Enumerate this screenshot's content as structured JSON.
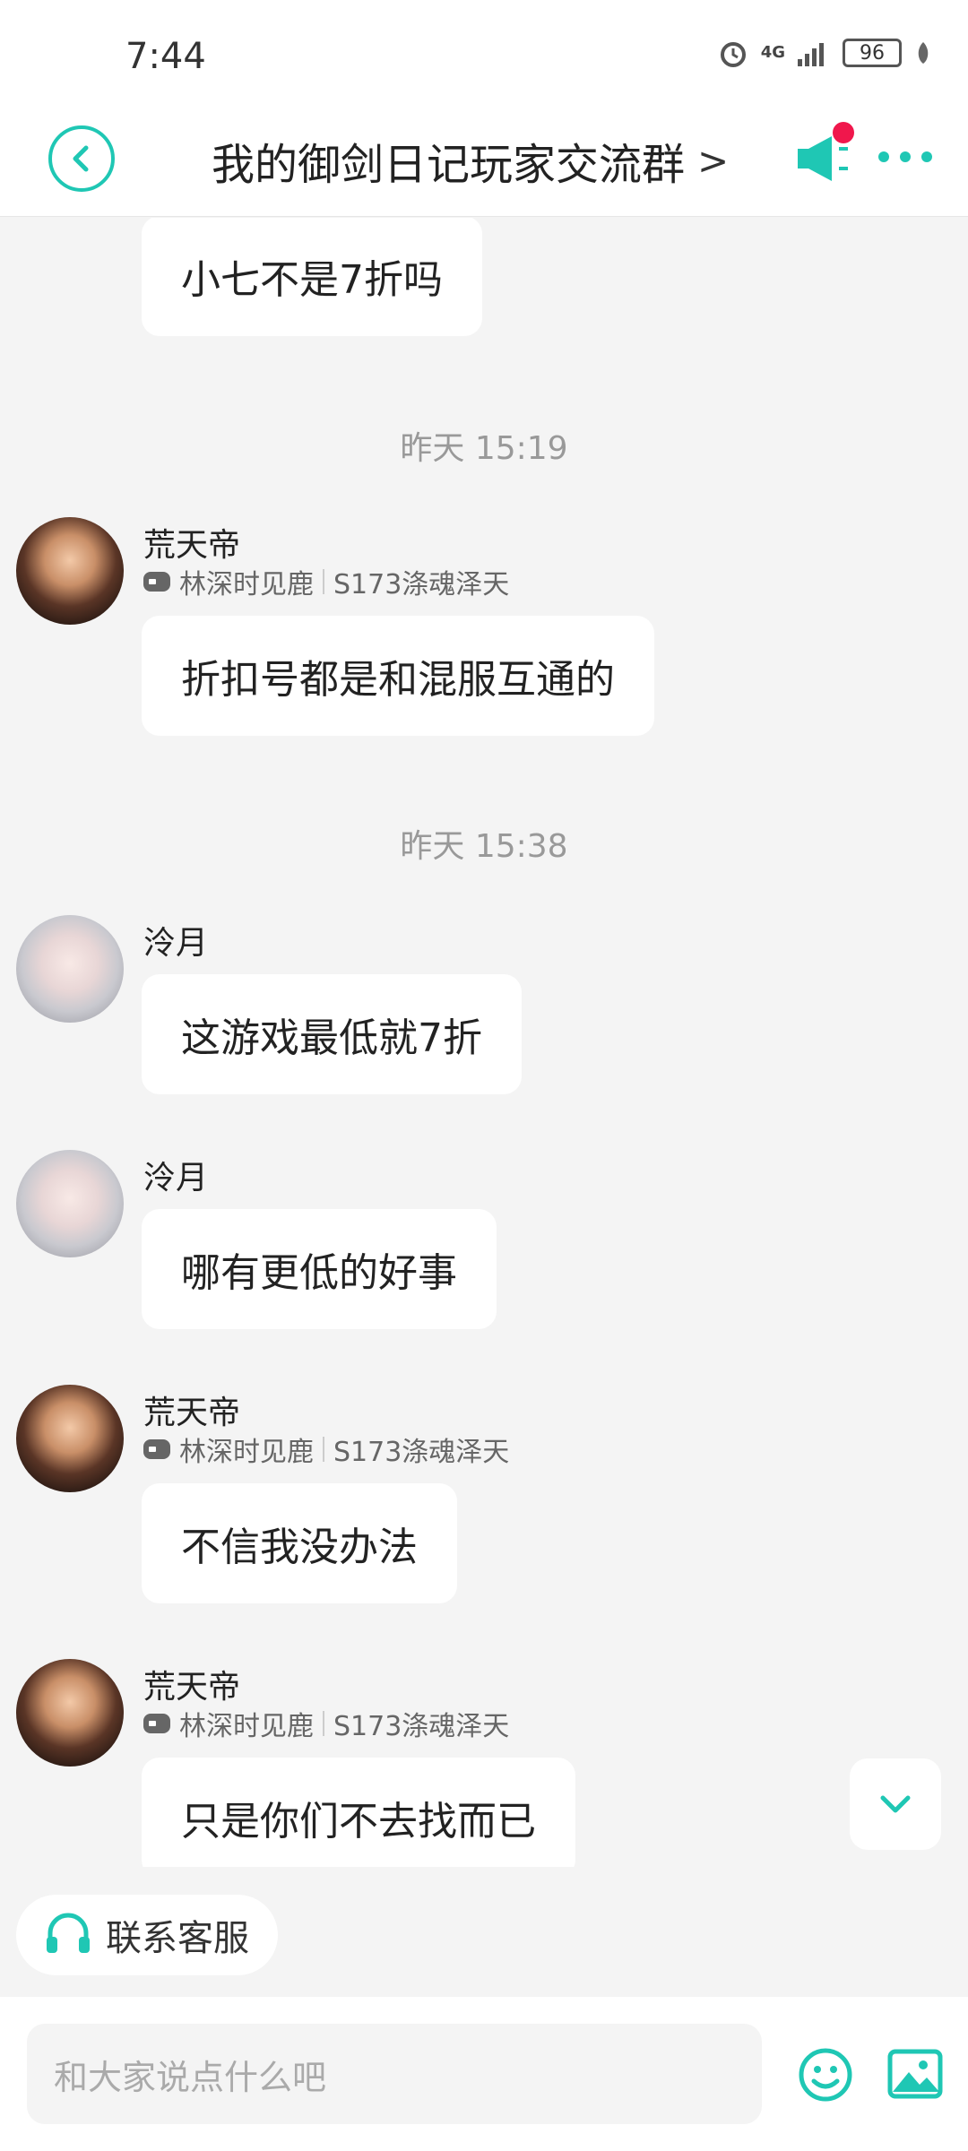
{
  "status_bar": {
    "time": "7:44",
    "network": "4G",
    "battery": "96"
  },
  "header": {
    "title": "我的御剑日记玩家交流群",
    "title_chevron": ">"
  },
  "messages": [
    {
      "text": "小七不是7折吗"
    },
    {
      "timestamp": "昨天 15:19"
    },
    {
      "sender": "荒天帝",
      "server": "林深时见鹿",
      "role": "S173涤魂泽天",
      "text": "折扣号都是和混服互通的"
    },
    {
      "timestamp": "昨天 15:38"
    },
    {
      "sender": "泠月",
      "text": "这游戏最低就7折"
    },
    {
      "sender": "泠月",
      "text": "哪有更低的好事"
    },
    {
      "sender": "荒天帝",
      "server": "林深时见鹿",
      "role": "S173涤魂泽天",
      "text": "不信我没办法"
    },
    {
      "sender": "荒天帝",
      "server": "林深时见鹿",
      "role": "S173涤魂泽天",
      "text": "只是你们不去找而已"
    }
  ],
  "service_button": {
    "label": "联系客服"
  },
  "composer": {
    "placeholder": "和大家说点什么吧"
  },
  "colors": {
    "accent": "#1fc7b4",
    "badge": "#f0174c",
    "background": "#f4f4f4"
  }
}
